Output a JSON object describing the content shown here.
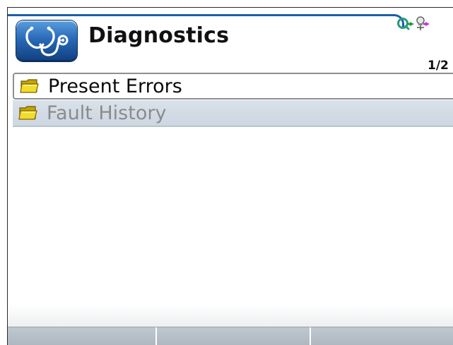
{
  "header": {
    "title": "Diagnostics",
    "page_indicator": "1/2",
    "app_icon": "stethoscope-icon",
    "accent_color": "#1a5fa8"
  },
  "status_bar": {
    "icons": [
      "network-status-icon",
      "power-status-icon"
    ]
  },
  "menu": {
    "items": [
      {
        "label": "Present Errors",
        "icon": "folder-icon",
        "selected": true
      },
      {
        "label": "Fault History",
        "icon": "folder-icon",
        "selected": false
      }
    ]
  },
  "softkeys": {
    "labels": [
      "",
      "",
      ""
    ]
  }
}
